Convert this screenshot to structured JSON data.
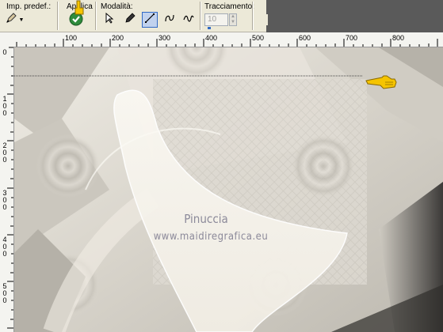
{
  "toolbar": {
    "presets_label": "Imp. predef.:",
    "apply_label": "Applica",
    "modes_label": "Modalità:",
    "tracing_label": "Tracciamento:",
    "tracing_value": "10"
  },
  "ruler": {
    "h_labels": [
      "100",
      "200",
      "300",
      "400",
      "500",
      "600",
      "700",
      "800"
    ],
    "v_labels": [
      "1 0 0",
      "2 0 0",
      "3 0 0",
      "4 0 0",
      "5 0 0"
    ],
    "v_top": "0"
  },
  "canvas": {
    "watermark_line1": "Pinuccia",
    "watermark_line2": "www.maidiregrafica.eu"
  },
  "colors": {
    "toolbar_bg": "#ece9d8",
    "accent_selected": "#316ac5",
    "apply_green": "#2e8b3c",
    "pointer_yellow": "#f5c400"
  },
  "icons": [
    "pen-tool-icon",
    "apply-check-icon",
    "hand-pointer-icon",
    "select-arrow-icon",
    "edit-pen-icon",
    "line-segment-icon",
    "curve-icon",
    "freehand-icon"
  ]
}
